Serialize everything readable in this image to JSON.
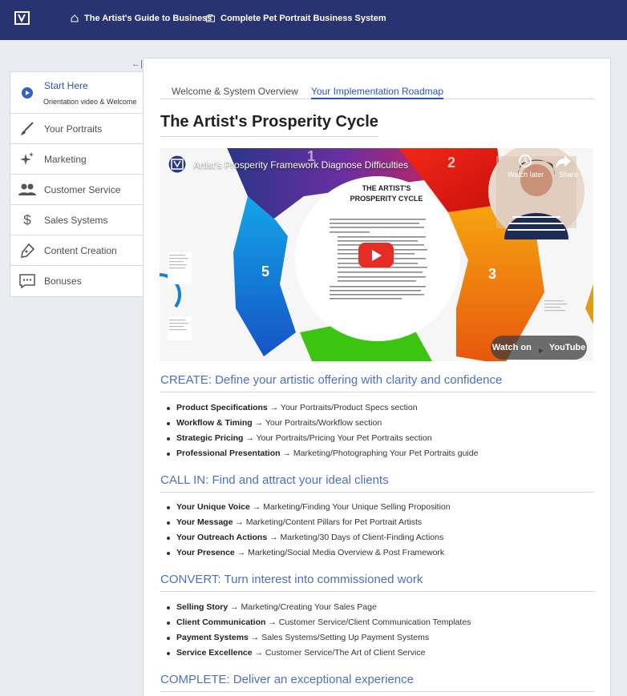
{
  "header": {
    "crumbs": [
      {
        "label": "The Artist's Guide to Business",
        "icon": "home-icon"
      },
      {
        "label": "Complete Pet Portrait Business System",
        "icon": "course-icon"
      }
    ]
  },
  "sidebar": {
    "items": [
      {
        "label": "Start Here",
        "sub": "Orientation video & Welcome",
        "icon": "play-circle-icon"
      },
      {
        "label": "Your Portraits",
        "icon": "brush-icon"
      },
      {
        "label": "Marketing",
        "icon": "sparkles-icon"
      },
      {
        "label": "Customer Service",
        "icon": "people-icon"
      },
      {
        "label": "Sales Systems",
        "icon": "dollar-icon"
      },
      {
        "label": "Content Creation",
        "icon": "pen-icon"
      },
      {
        "label": "Bonuses",
        "icon": "chat-dots-icon"
      }
    ]
  },
  "tabs": [
    "Welcome & System Overview",
    "Your Implementation Roadmap"
  ],
  "page_title": "The Artist's Prosperity Cycle",
  "video": {
    "title": "Artist's Prosperity Framework Diagnose Difficulties",
    "watch_later": "Watch later",
    "share": "Share",
    "watch_on": "Watch on",
    "youtube": "YouTube",
    "inner_title": "THE ARTIST'S PROSPERITY CYCLE",
    "segment_numbers": [
      "1",
      "2",
      "3",
      "5"
    ]
  },
  "sections": [
    {
      "heading": "CREATE: Define your artistic offering with clarity and confidence",
      "items": [
        {
          "bold": "Product Specifications",
          "text": " → Your Portraits/Product Specs section"
        },
        {
          "bold": "Workflow & Timing",
          "text": " → Your Portraits/Workflow section"
        },
        {
          "bold": "Strategic Pricing",
          "text": " → Your Portraits/Pricing Your Pet Portraits section"
        },
        {
          "bold": "Professional Presentation",
          "text": " → Marketing/Photographing Your Pet Portraits guide"
        }
      ]
    },
    {
      "heading": "CALL IN: Find and attract your ideal clients",
      "items": [
        {
          "bold": "Your Unique Voice",
          "text": " → Marketing/Finding Your Unique Selling Proposition"
        },
        {
          "bold": "Your Message",
          "text": " → Marketing/Content Pillars for Pet Portrait Artists"
        },
        {
          "bold": "Your Outreach Actions",
          "text": " → Marketing/30 Days of Client-Finding Actions"
        },
        {
          "bold": "Your Presence",
          "text": " → Marketing/Social Media Overview & Post Framework"
        }
      ]
    },
    {
      "heading": "CONVERT: Turn interest into commissioned work",
      "items": [
        {
          "bold": "Selling Story",
          "text": " → Marketing/Creating Your Sales Page"
        },
        {
          "bold": "Client Communication",
          "text": " → Customer Service/Client Communication Templates"
        },
        {
          "bold": "Payment Systems",
          "text": " → Sales Systems/Setting Up Payment Systems"
        },
        {
          "bold": "Service Excellence",
          "text": " → Customer Service/The Art of Client Service"
        }
      ]
    },
    {
      "heading": "COMPLETE: Deliver an exceptional experience",
      "items": []
    }
  ]
}
